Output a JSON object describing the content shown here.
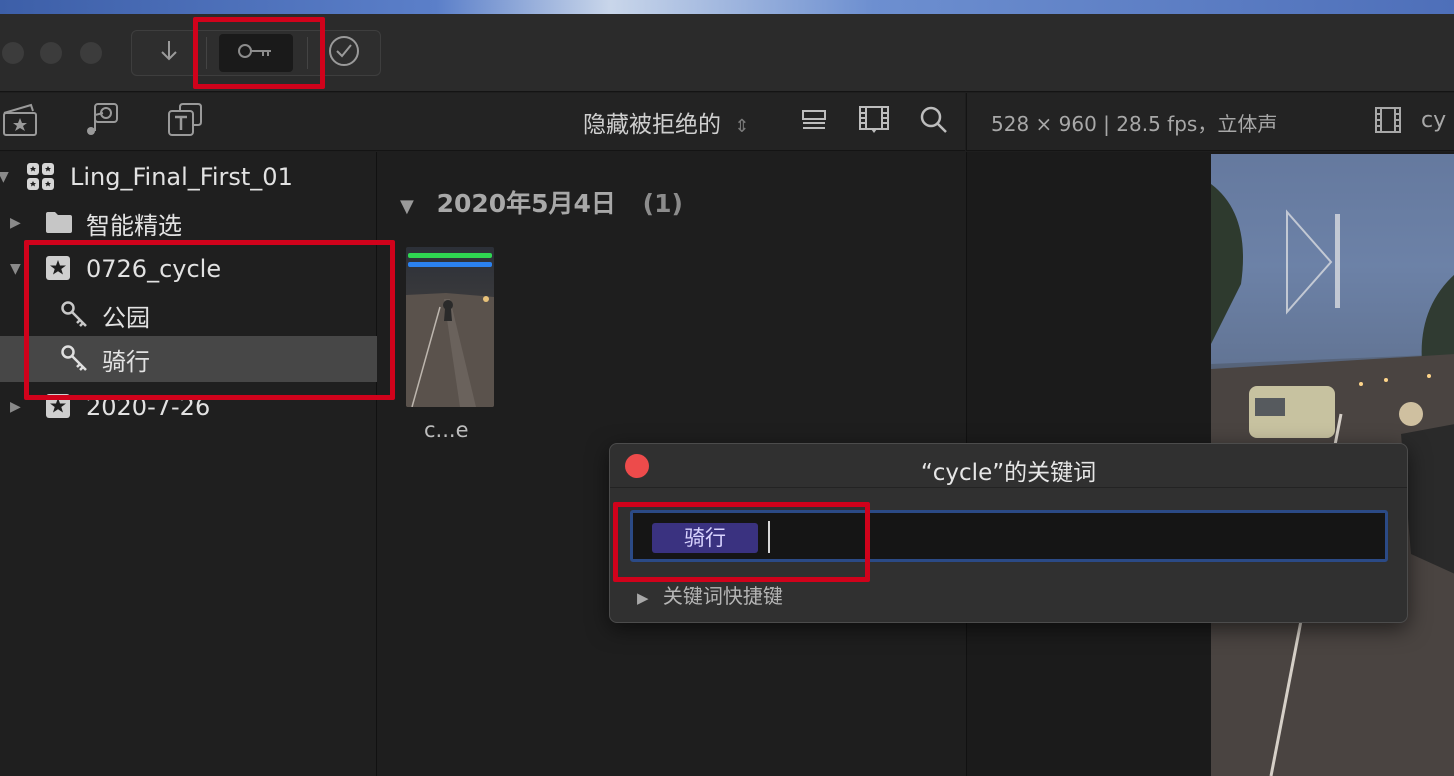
{
  "toolbar": {
    "buttons": [
      {
        "icon": "import-arrow-icon"
      },
      {
        "icon": "keyword-key-icon"
      },
      {
        "icon": "analyze-check-icon"
      }
    ]
  },
  "browser_header": {
    "icons": [
      "clapper-star-icon",
      "photos-music-icon",
      "titles-generators-icon"
    ],
    "filter": "隐藏被拒绝的",
    "right_icons": [
      "clip-appearance-icon",
      "filmstrip-icon",
      "search-icon"
    ]
  },
  "viewer_header": {
    "info": "528 × 960 | 28.5 fps，立体声",
    "clip_name": "cy"
  },
  "sidebar": {
    "library": "Ling_Final_First_01",
    "items": [
      {
        "label": "智能精选"
      },
      {
        "label": "0726_cycle"
      },
      {
        "label": "公园"
      },
      {
        "label": "骑行"
      },
      {
        "label": "2020-7-26"
      }
    ]
  },
  "browser": {
    "date_header": "2020年5月4日",
    "count": "(1)",
    "clip_name": "c...e",
    "clip_bar_colors": [
      "#2fd651",
      "#2b82f0"
    ]
  },
  "keyword_dialog": {
    "title": "“cycle”的关键词",
    "token": "骑行",
    "shortcuts_label": "关键词快捷键"
  },
  "colors": {
    "annotation": "#d0021b",
    "keyword_token": "#3a3280",
    "close_button": "#ed4b4b"
  }
}
